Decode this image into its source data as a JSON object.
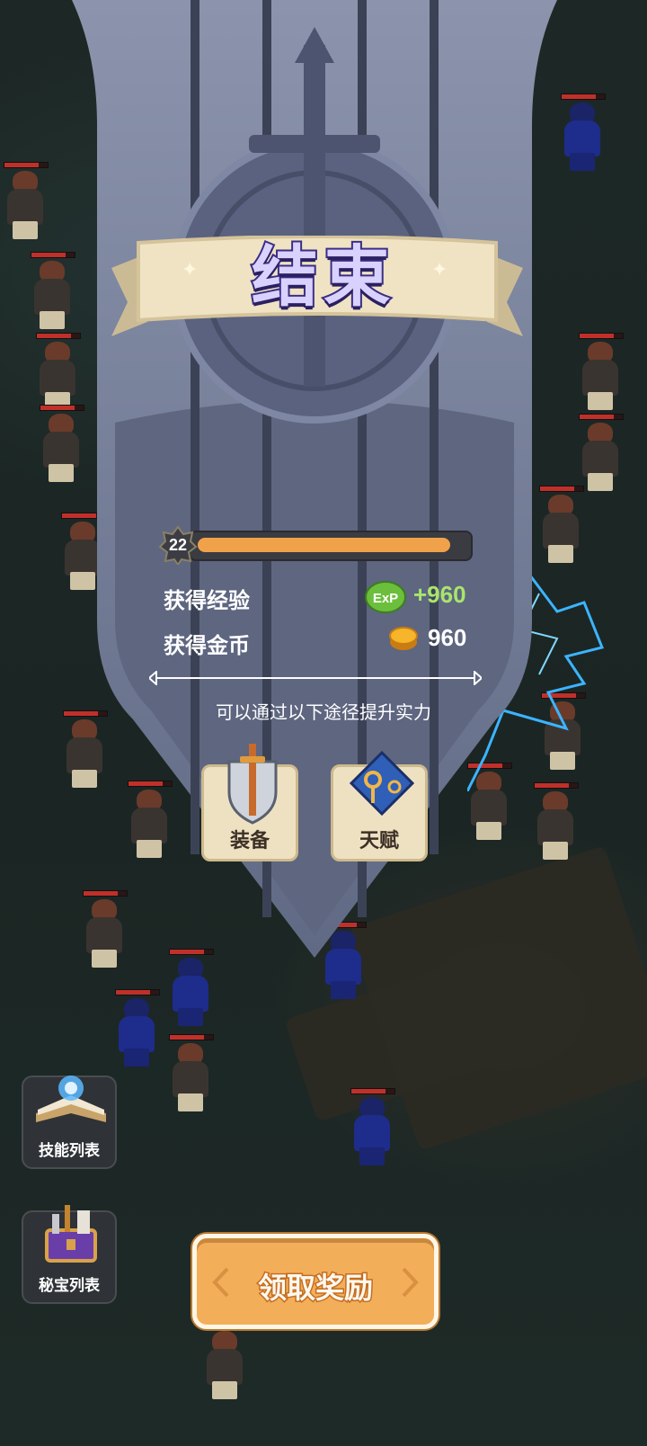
{
  "result": {
    "title": "结束",
    "level": "22",
    "level_progress": 0.95,
    "exp_label": "获得经验",
    "exp_value": "+960",
    "gold_label": "获得金币",
    "gold_value": "960",
    "hint": "可以通过以下途径提升实力",
    "upgrade_options": [
      {
        "label": "装备",
        "icon": "sword-shield-icon"
      },
      {
        "label": "天赋",
        "icon": "talent-key-icon"
      }
    ],
    "claim_label": "领取奖励"
  },
  "side_menu": [
    {
      "label": "技能列表",
      "icon": "skill-book-icon"
    },
    {
      "label": "秘宝列表",
      "icon": "treasure-chest-icon"
    }
  ],
  "exp_icon_text": "ExP",
  "colors": {
    "banner": "#6d7690",
    "ribbon": "#efe3c4",
    "title": "#d9d2ff",
    "exp": "#a8e56c",
    "bar": "#f0a24a",
    "claim": "#f3ae5a"
  }
}
